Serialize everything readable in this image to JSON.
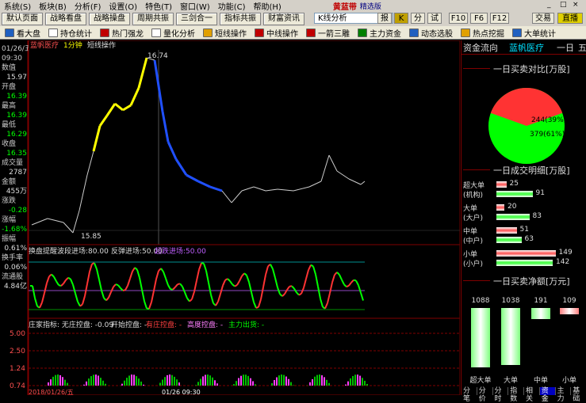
{
  "menu": {
    "items": [
      "系统(S)",
      "板块(B)",
      "分析(F)",
      "设置(O)",
      "特色(T)",
      "窗口(W)",
      "功能(C)",
      "帮助(H)"
    ],
    "brand": "黄蓝带",
    "sub": "精选版",
    "win": [
      "_",
      "□",
      "×"
    ]
  },
  "toolbar1": {
    "buttons": [
      "默认页面",
      "战略看盘",
      "战略操盘",
      "周期共振",
      "三剑合一",
      "指标共振",
      "财富资讯"
    ],
    "select_value": "K线分析",
    "icons": [
      "报",
      "K",
      "分",
      "试",
      "F10",
      "F6",
      "F12"
    ],
    "right": [
      "交易",
      "直播"
    ]
  },
  "toolbar2": {
    "items": [
      {
        "label": "看大盘",
        "color": "#2060c0"
      },
      {
        "label": "持仓统计",
        "color": "#ffffff"
      },
      {
        "label": "热门强龙",
        "color": "#c00000"
      },
      {
        "label": "量化分析",
        "color": "#ffffff"
      },
      {
        "label": "短线操作",
        "color": "#e0a000"
      },
      {
        "label": "中线操作",
        "color": "#c00000"
      },
      {
        "label": "一箭三雕",
        "color": "#c00000"
      },
      {
        "label": "主力资金",
        "color": "#008000"
      },
      {
        "label": "动态选股",
        "color": "#2060c0"
      },
      {
        "label": "热点挖掘",
        "color": "#e0a000"
      },
      {
        "label": "大单统计",
        "color": "#2060c0"
      }
    ]
  },
  "chart": {
    "stock_name": "蓝帆医疗",
    "period": "1分钟",
    "mode": "短线操作",
    "high_label": "16.74",
    "low_label": "15.85",
    "info": [
      {
        "label": "01/26/五",
        "value": "",
        "color": "#ddd"
      },
      {
        "label": "09:30",
        "value": "",
        "color": "#ddd"
      },
      {
        "label": "数值",
        "value": "15.97",
        "color": "#ddd"
      },
      {
        "label": "开盘",
        "value": "16.39",
        "color": "#00ff00"
      },
      {
        "label": "最高",
        "value": "16.39",
        "color": "#00ff00"
      },
      {
        "label": "最低",
        "value": "16.29",
        "color": "#00ff00"
      },
      {
        "label": "收盘",
        "value": "16.35",
        "color": "#00ff00"
      },
      {
        "label": "成交量",
        "value": "2787",
        "color": "#ddd"
      },
      {
        "label": "金额",
        "value": "455万",
        "color": "#ddd"
      },
      {
        "label": "涨跌",
        "value": "-0.28",
        "color": "#00ff00"
      },
      {
        "label": "涨幅",
        "value": "-1.68%",
        "color": "#00ff00"
      },
      {
        "label": "振幅",
        "value": "0.61%",
        "color": "#ddd"
      },
      {
        "label": "换手率",
        "value": "0.06%",
        "color": "#ddd"
      },
      {
        "label": "流通股",
        "value": "4.84亿",
        "color": "#ddd"
      }
    ],
    "ind1": {
      "name": "换盘提醒",
      "t1": "波段进场:80.00",
      "t2": "反弹进场:50.00",
      "t3": "超跌进场:50.00"
    },
    "ind2": {
      "name": "庄家指标",
      "t1": ": 无庄控盘: -0.09",
      "t2": "开始控盘: -",
      "t3": "有庄控盘: -",
      "t4": "高度控盘: -",
      "t5": "主力出货: -",
      "levels": [
        "5.00",
        "2.50",
        "1.24",
        "0.74"
      ]
    },
    "bottom_time": "01/26 09:30",
    "bottom_date": "2018/01/26/五"
  },
  "panel": {
    "title": "资金流向",
    "stock": "蓝帆医疗",
    "period": "一日",
    "five": "五",
    "sec1": "一日买卖对比[万股]",
    "pie": {
      "sell": "244(39%)",
      "buy": "379(61%)"
    },
    "sec2": "一日成交明细[万股]",
    "orders": [
      {
        "l1": "超大单",
        "l2": "(机构)",
        "buy": 25,
        "sell": 91
      },
      {
        "l1": "大单",
        "l2": "(大户)",
        "buy": 20,
        "sell": 83
      },
      {
        "l1": "中单",
        "l2": "(中户)",
        "buy": 51,
        "sell": 63
      },
      {
        "l1": "小单",
        "l2": "(小户)",
        "buy": 149,
        "sell": 142
      }
    ],
    "sec3": "一日买卖净额[万元]",
    "net": [
      {
        "label": "超大单",
        "value": "1088"
      },
      {
        "label": "大单",
        "value": "1038"
      },
      {
        "label": "中单",
        "value": "191"
      },
      {
        "label": "小单",
        "value": "109"
      }
    ],
    "tabs": [
      "分笔",
      "分价",
      "分时",
      "指数",
      "相关",
      "资金",
      "主力",
      "基础"
    ]
  },
  "colors": {
    "up": "#ff3333",
    "down": "#00ff00",
    "accent": "#e0e000",
    "grid": "#800000"
  }
}
